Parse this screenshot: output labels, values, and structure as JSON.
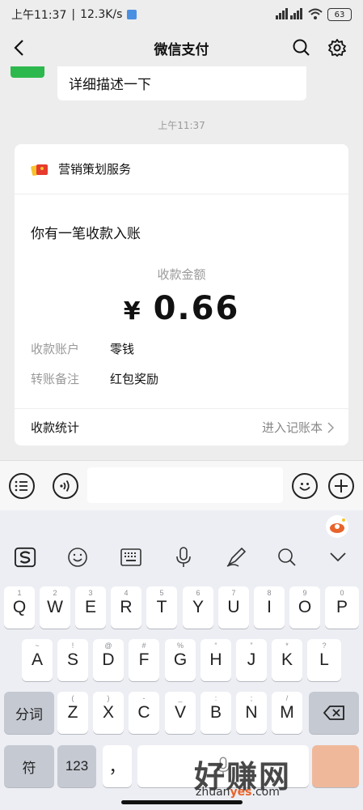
{
  "status": {
    "time": "上午11:37",
    "speed": "12.3K/s",
    "battery": "63"
  },
  "nav": {
    "title": "微信支付"
  },
  "chat": {
    "prev_message": "详细描述一下",
    "timestamp": "上午11:37"
  },
  "card": {
    "service_name": "营销策划服务",
    "title": "你有一笔收款入账",
    "amount_label": "收款金额",
    "currency": "¥",
    "amount": "0.66",
    "rows": [
      {
        "key": "收款账户",
        "value": "零钱"
      },
      {
        "key": "转账备注",
        "value": "红包奖励"
      }
    ],
    "footer_left": "收款统计",
    "footer_right": "进入记账本"
  },
  "keyboard": {
    "row1": [
      {
        "k": "Q",
        "s": "1"
      },
      {
        "k": "W",
        "s": "2"
      },
      {
        "k": "E",
        "s": "3"
      },
      {
        "k": "R",
        "s": "4"
      },
      {
        "k": "T",
        "s": "5"
      },
      {
        "k": "Y",
        "s": "6"
      },
      {
        "k": "U",
        "s": "7"
      },
      {
        "k": "I",
        "s": "8"
      },
      {
        "k": "O",
        "s": "9"
      },
      {
        "k": "P",
        "s": "0"
      }
    ],
    "row2": [
      {
        "k": "A",
        "s": "~"
      },
      {
        "k": "S",
        "s": "!"
      },
      {
        "k": "D",
        "s": "@"
      },
      {
        "k": "F",
        "s": "#"
      },
      {
        "k": "G",
        "s": "%"
      },
      {
        "k": "H",
        "s": "“"
      },
      {
        "k": "J",
        "s": "”"
      },
      {
        "k": "K",
        "s": "*"
      },
      {
        "k": "L",
        "s": "?"
      }
    ],
    "row3": [
      {
        "k": "Z",
        "s": "("
      },
      {
        "k": "X",
        "s": ")"
      },
      {
        "k": "C",
        "s": "-"
      },
      {
        "k": "V",
        "s": "_"
      },
      {
        "k": "B",
        "s": ":"
      },
      {
        "k": "N",
        "s": ";"
      },
      {
        "k": "M",
        "s": "/"
      }
    ],
    "fenci": "分词",
    "fu": "符",
    "num": "123",
    "comma": "，"
  },
  "watermark": {
    "text": "好赚网",
    "url_a": "zhuan",
    "url_b": "yes",
    "url_c": ".com"
  }
}
